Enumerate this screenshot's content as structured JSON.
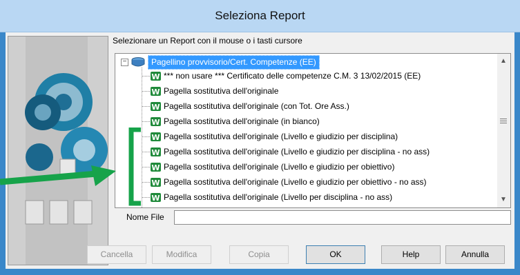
{
  "window": {
    "title": "Seleziona Report"
  },
  "instructions": "Selezionare un Report con il mouse o i tasti cursore",
  "tree": {
    "root_label": "Pagellino provvisorio/Cert. Competenze (EE)",
    "items": [
      "*** non usare *** Certificato delle competenze C.M. 3 13/02/2015 (EE)",
      "Pagella sostitutiva dell'originale",
      "Pagella sostitutiva dell'originale (con Tot. Ore Ass.)",
      "Pagella sostitutiva dell'originale (in bianco)",
      "Pagella sostitutiva dell'originale (Livello e giudizio per disciplina)",
      "Pagella sostitutiva dell'originale (Livello e giudizio per disciplina - no ass)",
      "Pagella sostitutiva dell'originale (Livello e giudizio per obiettivo)",
      "Pagella sostitutiva dell'originale (Livello e giudizio per obiettivo - no ass)",
      "Pagella sostitutiva dell'originale (Livello per disciplina - no ass)"
    ]
  },
  "nome_file": {
    "label": "Nome File",
    "value": ""
  },
  "buttons": {
    "cancella": "Cancella",
    "modifica": "Modifica",
    "copia": "Copia",
    "ok": "OK",
    "help": "Help",
    "annulla": "Annulla"
  },
  "colors": {
    "selection": "#3399ff",
    "annotation": "#16a34a",
    "titlebar": "#b9d7f3",
    "frame": "#3a87c9"
  },
  "icons": {
    "report_item": "report-icon",
    "root": "database-icon"
  }
}
